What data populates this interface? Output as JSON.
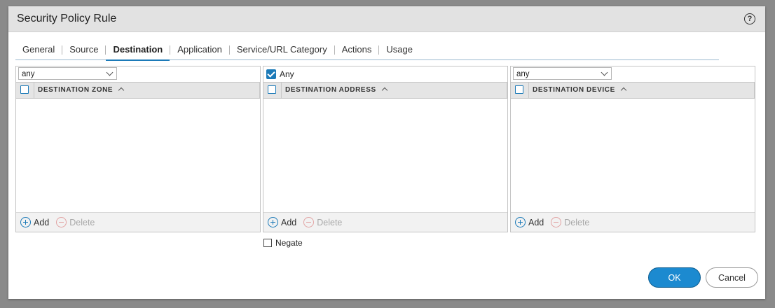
{
  "dialog": {
    "title": "Security Policy Rule",
    "help_icon": "help-icon",
    "help_glyph": "?"
  },
  "tabs": [
    {
      "label": "General"
    },
    {
      "label": "Source"
    },
    {
      "label": "Destination",
      "active": true
    },
    {
      "label": "Application"
    },
    {
      "label": "Service/URL Category"
    },
    {
      "label": "Actions"
    },
    {
      "label": "Usage"
    }
  ],
  "zone_panel": {
    "select_value": "any",
    "column_header": "DESTINATION ZONE",
    "add_label": "Add",
    "delete_label": "Delete"
  },
  "address_panel": {
    "any_label": "Any",
    "any_checked": true,
    "column_header": "DESTINATION ADDRESS",
    "add_label": "Add",
    "delete_label": "Delete"
  },
  "device_panel": {
    "select_value": "any",
    "column_header": "DESTINATION DEVICE",
    "add_label": "Add",
    "delete_label": "Delete"
  },
  "negate": {
    "label": "Negate",
    "checked": false
  },
  "buttons": {
    "ok": "OK",
    "cancel": "Cancel"
  },
  "colors": {
    "accent": "#1c7ab8",
    "ok_bg": "#1c8ad0",
    "titlebar": "#e2e2e2"
  }
}
